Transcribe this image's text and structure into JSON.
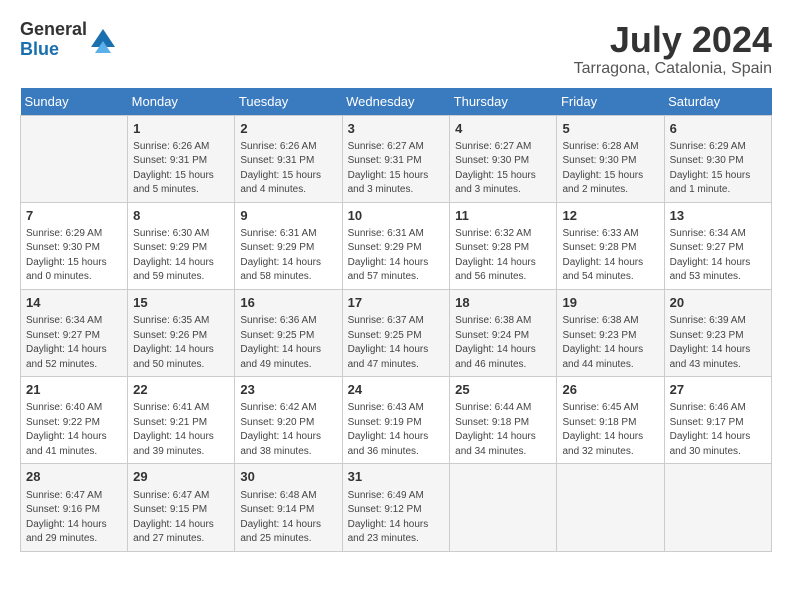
{
  "header": {
    "logo_general": "General",
    "logo_blue": "Blue",
    "month_title": "July 2024",
    "location": "Tarragona, Catalonia, Spain"
  },
  "days_of_week": [
    "Sunday",
    "Monday",
    "Tuesday",
    "Wednesday",
    "Thursday",
    "Friday",
    "Saturday"
  ],
  "weeks": [
    [
      {
        "day": "",
        "info": ""
      },
      {
        "day": "1",
        "info": "Sunrise: 6:26 AM\nSunset: 9:31 PM\nDaylight: 15 hours\nand 5 minutes."
      },
      {
        "day": "2",
        "info": "Sunrise: 6:26 AM\nSunset: 9:31 PM\nDaylight: 15 hours\nand 4 minutes."
      },
      {
        "day": "3",
        "info": "Sunrise: 6:27 AM\nSunset: 9:31 PM\nDaylight: 15 hours\nand 3 minutes."
      },
      {
        "day": "4",
        "info": "Sunrise: 6:27 AM\nSunset: 9:30 PM\nDaylight: 15 hours\nand 3 minutes."
      },
      {
        "day": "5",
        "info": "Sunrise: 6:28 AM\nSunset: 9:30 PM\nDaylight: 15 hours\nand 2 minutes."
      },
      {
        "day": "6",
        "info": "Sunrise: 6:29 AM\nSunset: 9:30 PM\nDaylight: 15 hours\nand 1 minute."
      }
    ],
    [
      {
        "day": "7",
        "info": "Sunrise: 6:29 AM\nSunset: 9:30 PM\nDaylight: 15 hours\nand 0 minutes."
      },
      {
        "day": "8",
        "info": "Sunrise: 6:30 AM\nSunset: 9:29 PM\nDaylight: 14 hours\nand 59 minutes."
      },
      {
        "day": "9",
        "info": "Sunrise: 6:31 AM\nSunset: 9:29 PM\nDaylight: 14 hours\nand 58 minutes."
      },
      {
        "day": "10",
        "info": "Sunrise: 6:31 AM\nSunset: 9:29 PM\nDaylight: 14 hours\nand 57 minutes."
      },
      {
        "day": "11",
        "info": "Sunrise: 6:32 AM\nSunset: 9:28 PM\nDaylight: 14 hours\nand 56 minutes."
      },
      {
        "day": "12",
        "info": "Sunrise: 6:33 AM\nSunset: 9:28 PM\nDaylight: 14 hours\nand 54 minutes."
      },
      {
        "day": "13",
        "info": "Sunrise: 6:34 AM\nSunset: 9:27 PM\nDaylight: 14 hours\nand 53 minutes."
      }
    ],
    [
      {
        "day": "14",
        "info": "Sunrise: 6:34 AM\nSunset: 9:27 PM\nDaylight: 14 hours\nand 52 minutes."
      },
      {
        "day": "15",
        "info": "Sunrise: 6:35 AM\nSunset: 9:26 PM\nDaylight: 14 hours\nand 50 minutes."
      },
      {
        "day": "16",
        "info": "Sunrise: 6:36 AM\nSunset: 9:25 PM\nDaylight: 14 hours\nand 49 minutes."
      },
      {
        "day": "17",
        "info": "Sunrise: 6:37 AM\nSunset: 9:25 PM\nDaylight: 14 hours\nand 47 minutes."
      },
      {
        "day": "18",
        "info": "Sunrise: 6:38 AM\nSunset: 9:24 PM\nDaylight: 14 hours\nand 46 minutes."
      },
      {
        "day": "19",
        "info": "Sunrise: 6:38 AM\nSunset: 9:23 PM\nDaylight: 14 hours\nand 44 minutes."
      },
      {
        "day": "20",
        "info": "Sunrise: 6:39 AM\nSunset: 9:23 PM\nDaylight: 14 hours\nand 43 minutes."
      }
    ],
    [
      {
        "day": "21",
        "info": "Sunrise: 6:40 AM\nSunset: 9:22 PM\nDaylight: 14 hours\nand 41 minutes."
      },
      {
        "day": "22",
        "info": "Sunrise: 6:41 AM\nSunset: 9:21 PM\nDaylight: 14 hours\nand 39 minutes."
      },
      {
        "day": "23",
        "info": "Sunrise: 6:42 AM\nSunset: 9:20 PM\nDaylight: 14 hours\nand 38 minutes."
      },
      {
        "day": "24",
        "info": "Sunrise: 6:43 AM\nSunset: 9:19 PM\nDaylight: 14 hours\nand 36 minutes."
      },
      {
        "day": "25",
        "info": "Sunrise: 6:44 AM\nSunset: 9:18 PM\nDaylight: 14 hours\nand 34 minutes."
      },
      {
        "day": "26",
        "info": "Sunrise: 6:45 AM\nSunset: 9:18 PM\nDaylight: 14 hours\nand 32 minutes."
      },
      {
        "day": "27",
        "info": "Sunrise: 6:46 AM\nSunset: 9:17 PM\nDaylight: 14 hours\nand 30 minutes."
      }
    ],
    [
      {
        "day": "28",
        "info": "Sunrise: 6:47 AM\nSunset: 9:16 PM\nDaylight: 14 hours\nand 29 minutes."
      },
      {
        "day": "29",
        "info": "Sunrise: 6:47 AM\nSunset: 9:15 PM\nDaylight: 14 hours\nand 27 minutes."
      },
      {
        "day": "30",
        "info": "Sunrise: 6:48 AM\nSunset: 9:14 PM\nDaylight: 14 hours\nand 25 minutes."
      },
      {
        "day": "31",
        "info": "Sunrise: 6:49 AM\nSunset: 9:12 PM\nDaylight: 14 hours\nand 23 minutes."
      },
      {
        "day": "",
        "info": ""
      },
      {
        "day": "",
        "info": ""
      },
      {
        "day": "",
        "info": ""
      }
    ]
  ]
}
